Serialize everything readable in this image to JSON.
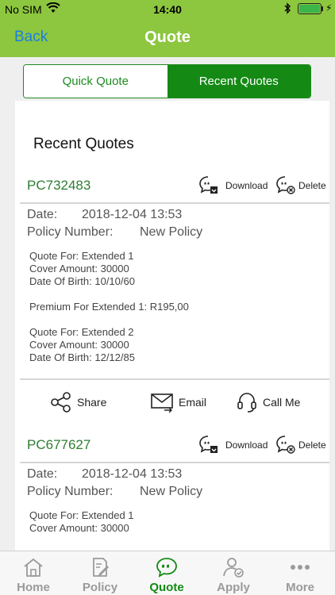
{
  "status_bar": {
    "carrier": "No SIM",
    "time": "14:40"
  },
  "nav": {
    "back_label": "Back",
    "title": "Quote"
  },
  "segments": {
    "quick": "Quick Quote",
    "recent": "Recent Quotes"
  },
  "card": {
    "heading": "Recent Quotes"
  },
  "labels": {
    "download": "Download",
    "delete": "Delete",
    "date": "Date:",
    "policy_number": "Policy Number:",
    "share": "Share",
    "email": "Email",
    "call_me": "Call Me"
  },
  "quotes": [
    {
      "id": "PC732483",
      "date": "2018-12-04 13:53",
      "policy_number": "New Policy",
      "lines": [
        "Quote For: Extended 1",
        "Cover Amount: 30000",
        "Date Of Birth: 10/10/60",
        "Premium For Extended 1: R195,00",
        "Quote For: Extended 2",
        "Cover Amount: 30000",
        "Date Of Birth: 12/12/85"
      ]
    },
    {
      "id": "PC677627",
      "date": "2018-12-04 13:53",
      "policy_number": "New Policy",
      "lines": [
        "Quote For: Extended 1",
        "Cover Amount: 30000"
      ]
    }
  ],
  "tabs": [
    {
      "label": "Home",
      "icon": "home-icon",
      "active": false
    },
    {
      "label": "Policy",
      "icon": "policy-icon",
      "active": false
    },
    {
      "label": "Quote",
      "icon": "quote-icon",
      "active": true
    },
    {
      "label": "Apply",
      "icon": "apply-icon",
      "active": false
    },
    {
      "label": "More",
      "icon": "more-icon",
      "active": false
    }
  ],
  "colors": {
    "brand_green": "#8dc63f",
    "accent_green": "#148a14",
    "link_blue": "#1a7fe0"
  }
}
